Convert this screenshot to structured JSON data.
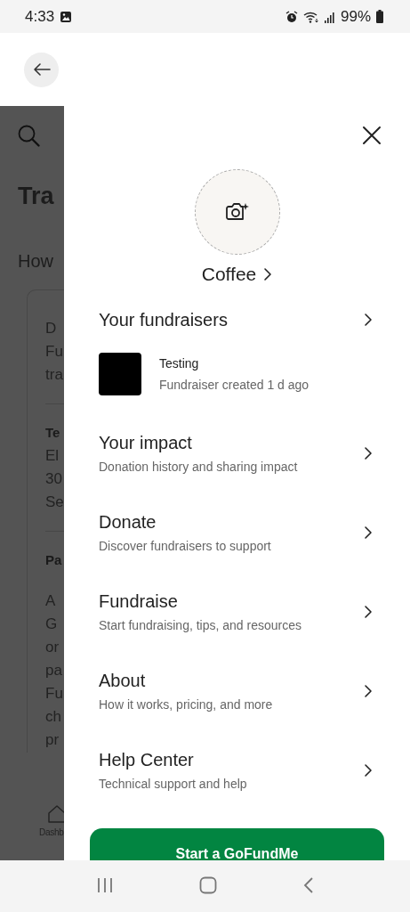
{
  "status_bar": {
    "time": "4:33",
    "battery": "99%"
  },
  "background_page": {
    "title": "Tra",
    "subtitle": "How",
    "card_sections": [
      {
        "lines": [
          "D",
          "Fu",
          "tra"
        ]
      },
      {
        "heading": "Te",
        "lines": [
          "El",
          "30",
          "Se"
        ]
      },
      {
        "heading": "Pa",
        "lines": [
          "A",
          "G",
          "or",
          "pa",
          "Fu",
          "ch",
          "pr"
        ]
      }
    ],
    "tab_label": "Dashb"
  },
  "drawer": {
    "profile_name": "Coffee",
    "fundraisers_title": "Your fundraisers",
    "fundraisers": [
      {
        "title": "Testing",
        "subtitle": "Fundraiser created 1 d ago"
      }
    ],
    "menu_items": [
      {
        "title": "Your impact",
        "subtitle": "Donation history and sharing impact"
      },
      {
        "title": "Donate",
        "subtitle": "Discover fundraisers to support"
      },
      {
        "title": "Fundraise",
        "subtitle": "Start fundraising, tips, and resources"
      },
      {
        "title": "About",
        "subtitle": "How it works, pricing, and more"
      },
      {
        "title": "Help Center",
        "subtitle": "Technical support and help"
      }
    ],
    "primary_button": "Start a GoFundMe"
  }
}
